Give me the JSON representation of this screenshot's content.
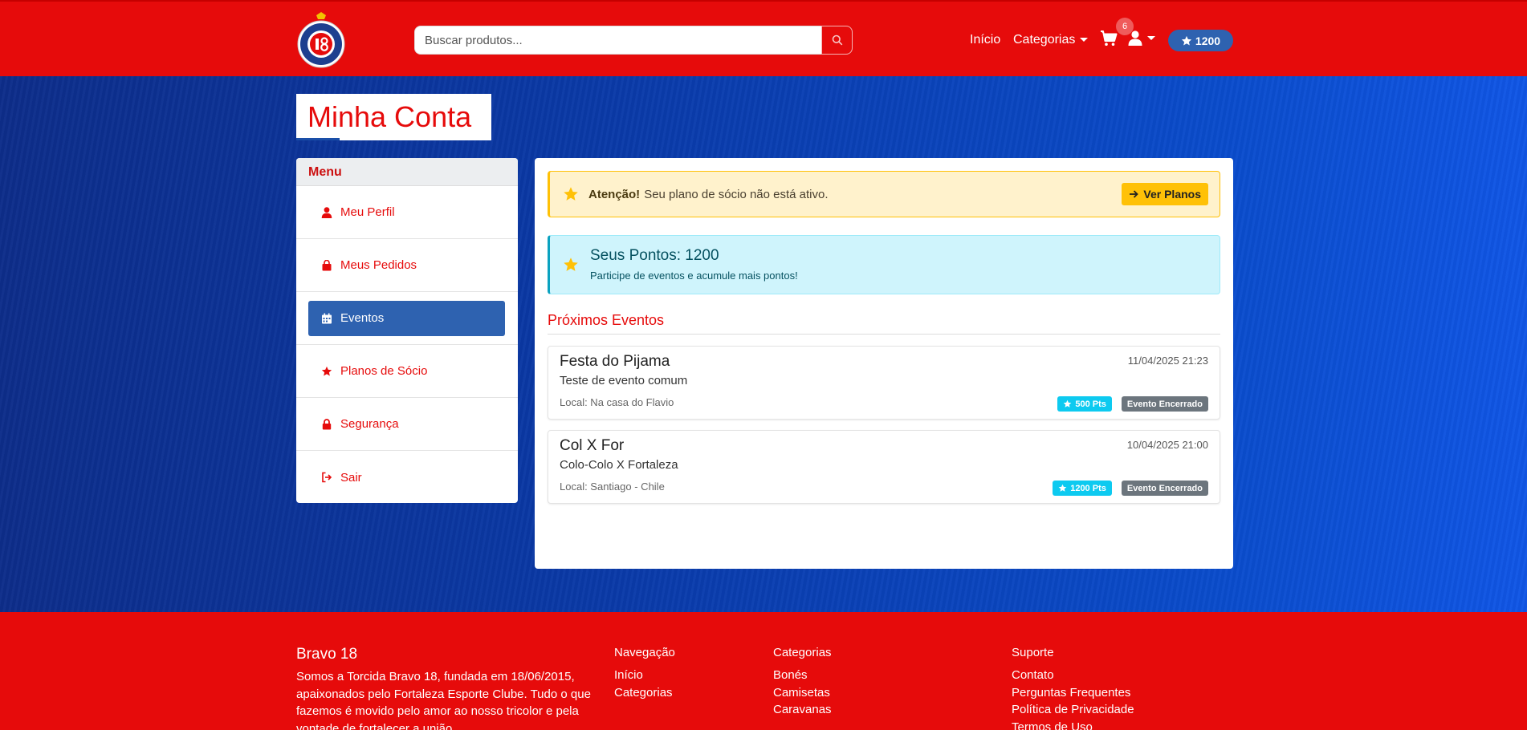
{
  "colors": {
    "brand_red": "#e60b0b",
    "primary_blue": "#2e62b0",
    "warning": "#ffc107",
    "info": "#0dcaf0"
  },
  "header": {
    "search_placeholder": "Buscar produtos...",
    "nav_inicio": "Início",
    "nav_categorias": "Categorias",
    "cart_count": "6",
    "points": "1200",
    "icons": [
      "search-icon",
      "cart-icon",
      "user-icon",
      "star-icon"
    ]
  },
  "page": {
    "title": "Minha Conta"
  },
  "sidebar": {
    "heading": "Menu",
    "items": [
      {
        "label": "Meu Perfil",
        "icon": "user-icon",
        "active": false
      },
      {
        "label": "Meus Pedidos",
        "icon": "bag-icon",
        "active": false
      },
      {
        "label": "Eventos",
        "icon": "calendar-icon",
        "active": true
      },
      {
        "label": "Planos de Sócio",
        "icon": "star-icon",
        "active": false
      },
      {
        "label": "Segurança",
        "icon": "lock-icon",
        "active": false
      },
      {
        "label": "Sair",
        "icon": "logout-icon",
        "active": false
      }
    ]
  },
  "alert": {
    "strong": "Atenção!",
    "text": "Seu plano de sócio não está ativo.",
    "button": "Ver Planos"
  },
  "points_box": {
    "title": "Seus Pontos: 1200",
    "subtitle": "Participe de eventos e acumule mais pontos!"
  },
  "events": {
    "heading": "Próximos Eventos",
    "items": [
      {
        "name": "Festa do Pijama",
        "date": "11/04/2025 21:23",
        "description": "Teste de evento comum",
        "local": "Local: Na casa do Flavio",
        "points": "500 Pts",
        "status": "Evento Encerrado"
      },
      {
        "name": "Col X For",
        "date": "10/04/2025 21:00",
        "description": "Colo-Colo X Fortaleza",
        "local": "Local: Santiago - Chile",
        "points": "1200 Pts",
        "status": "Evento Encerrado"
      }
    ]
  },
  "footer": {
    "brand": "Bravo 18",
    "about": "Somos a Torcida Bravo 18, fundada em 18/06/2015, apaixonados pelo Fortaleza Esporte Clube. Tudo o que fazemos é movido pelo amor ao nosso tricolor e pela vontade de fortalecer a união",
    "navegacao": {
      "title": "Navegação",
      "links": [
        "Início",
        "Categorias"
      ]
    },
    "categorias": {
      "title": "Categorias",
      "links": [
        "Bonés",
        "Camisetas",
        "Caravanas"
      ]
    },
    "suporte": {
      "title": "Suporte",
      "links": [
        "Contato",
        "Perguntas Frequentes",
        "Política de Privacidade",
        "Termos de Uso"
      ]
    }
  }
}
